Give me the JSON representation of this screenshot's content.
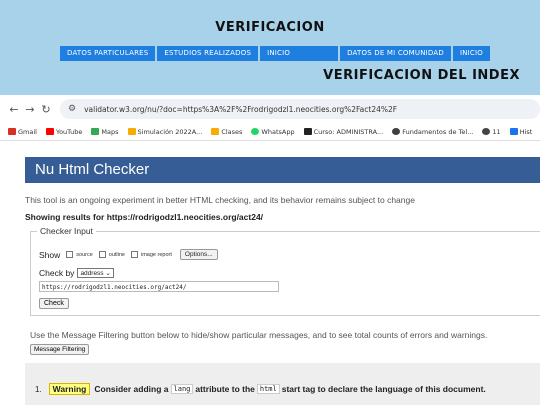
{
  "site": {
    "title": "VERIFICACION",
    "nav": [
      "DATOS PARTICULARES",
      "ESTUDIOS REALIZADOS",
      "INICIO",
      "DATOS DE MI COMUNIDAD",
      "INICIO"
    ],
    "heading": "VERIFICACION DEL INDEX"
  },
  "browser": {
    "url": "validator.w3.org/nu/?doc=https%3A%2F%2Frodrigodzl1.neocities.org%2Fact24%2F",
    "bookmarks": [
      "Gmail",
      "YouTube",
      "Maps",
      "Simulación 2022A...",
      "Clases",
      "WhatsApp",
      "Curso: ADMINISTRA...",
      "Fundamentos de Tel...",
      "11",
      "Hist"
    ]
  },
  "checker": {
    "title": "Nu Html Checker",
    "intro": "This tool is an ongoing experiment in better HTML checking, and its behavior remains subject to change",
    "showing": "Showing results for https://rodrigodzl1.neocities.org/act24/",
    "input_legend": "Checker Input",
    "show_label": "Show",
    "show_options": [
      "source",
      "outline",
      "image report"
    ],
    "options_button": "Options...",
    "checkby_label": "Check by",
    "checkby_value": "address",
    "url_value": "https://rodrigodzl1.neocities.org/act24/",
    "check_button": "Check",
    "filter_note": "Use the Message Filtering button below to hide/show particular messages, and to see total counts of errors and warnings.",
    "filter_button": "Message Filtering",
    "message": {
      "number": "1.",
      "type": "Warning",
      "text_1": "Consider adding a",
      "code_1": "lang",
      "text_2": "attribute to the",
      "code_2": "html",
      "text_3": "start tag to declare the language of this document."
    }
  }
}
